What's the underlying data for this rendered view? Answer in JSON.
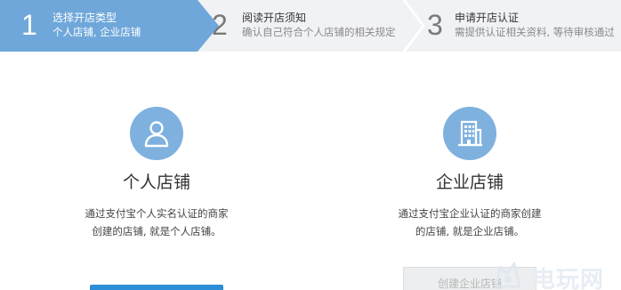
{
  "steps": [
    {
      "number": "1",
      "title": "选择开店类型",
      "subtitle": "个人店铺, 企业店铺",
      "active": true
    },
    {
      "number": "2",
      "title": "阅读开店须知",
      "subtitle": "确认自己符合个人店铺的相关规定",
      "active": false
    },
    {
      "number": "3",
      "title": "申请开店认证",
      "subtitle": "需提供认证相关资料, 等待审核通过",
      "active": false
    }
  ],
  "cards": {
    "personal": {
      "icon": "user-icon",
      "title": "个人店铺",
      "description": "通过支付宝个人实名认证的商家创建的店铺, 就是个人店铺。",
      "button_label": ""
    },
    "enterprise": {
      "icon": "building-icon",
      "title": "企业店铺",
      "description": "通过支付宝企业认证的商家创建的店铺, 就是企业店铺。",
      "button_label": "创建企业店铺"
    }
  },
  "watermark": {
    "text": "电玩网"
  },
  "colors": {
    "active_step": "#6fa7da",
    "stepper_bg": "#f1f2f4",
    "icon_circle": "#7fb1df",
    "primary_button": "#2b8ed6"
  }
}
